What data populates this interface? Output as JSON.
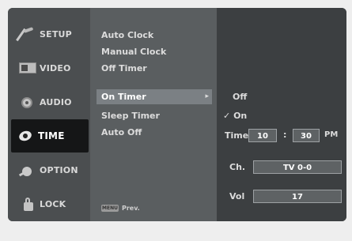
{
  "tabs": [
    {
      "label": "SETUP",
      "icon": "wrench-icon"
    },
    {
      "label": "VIDEO",
      "icon": "monitor-icon"
    },
    {
      "label": "AUDIO",
      "icon": "speaker-icon"
    },
    {
      "label": "TIME",
      "icon": "clock-icon",
      "active": true
    },
    {
      "label": "OPTION",
      "icon": "option-icon"
    },
    {
      "label": "LOCK",
      "icon": "lock-icon"
    }
  ],
  "menu": {
    "items": [
      "Auto Clock",
      "Manual Clock",
      "Off Timer",
      "On Timer",
      "Sleep Timer",
      "Auto Off"
    ],
    "selected": "On Timer",
    "arrow": "▸",
    "prev_key": "MENU",
    "prev_label": "Prev."
  },
  "on_timer": {
    "off_label": "Off",
    "on_label": "On",
    "check_mark": "✓",
    "time_label": "Time",
    "hour": "10",
    "colon": ":",
    "minute": "30",
    "ampm": "PM",
    "channel_label": "Ch.",
    "channel_value": "TV 0-0",
    "volume_label": "Vol",
    "volume_value": "17"
  },
  "colors": {
    "osd_background": "#3f4244",
    "active_tab": "#151617",
    "selected_item": "#7b8084"
  }
}
